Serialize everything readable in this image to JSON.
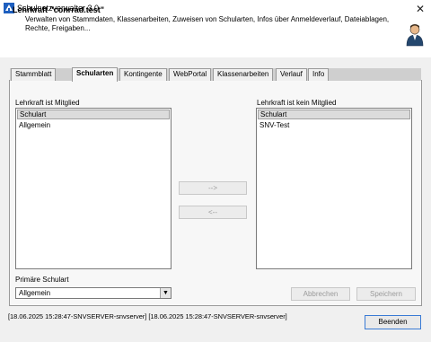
{
  "window": {
    "title": "Schulnetzverwalter 3.0",
    "close_glyph": "✕"
  },
  "header": {
    "title": "Lehrkraft \"conrrad.test\"",
    "description": "Verwalten von Stammdaten, Klassenarbeiten, Zuweisen von Schularten, Infos über Anmeldeverlauf, Dateiablagen, Rechte, Freigaben..."
  },
  "tabs": [
    {
      "label": "Stammblatt"
    },
    {
      "label": "Schularten"
    },
    {
      "label": "Kontingente"
    },
    {
      "label": "WebPortal"
    },
    {
      "label": "Klassenarbeiten"
    },
    {
      "label": "Verlauf"
    },
    {
      "label": "Info"
    }
  ],
  "member_list": {
    "label": "Lehrkraft ist Mitglied",
    "column": "Schulart",
    "rows": [
      "Allgemein"
    ]
  },
  "non_member_list": {
    "label": "Lehrkraft ist kein Mitglied",
    "column": "Schulart",
    "rows": [
      "SNV-Test"
    ]
  },
  "move_buttons": {
    "add": "-->",
    "remove": "<--"
  },
  "primary": {
    "label": "Primäre Schulart",
    "value": "Allgemein",
    "arrow": "▼"
  },
  "actions": {
    "cancel": "Abbrechen",
    "save": "Speichern"
  },
  "status": "[18.06.2025 15:28:47-SNVSERVER-snvserver] [18.06.2025 15:28:47-SNVSERVER-snvserver]",
  "footer": {
    "close": "Beenden"
  },
  "colors": {
    "accent": "#3a7bd5",
    "panel": "#f7f7f7",
    "header_bg": "#ffffff"
  }
}
